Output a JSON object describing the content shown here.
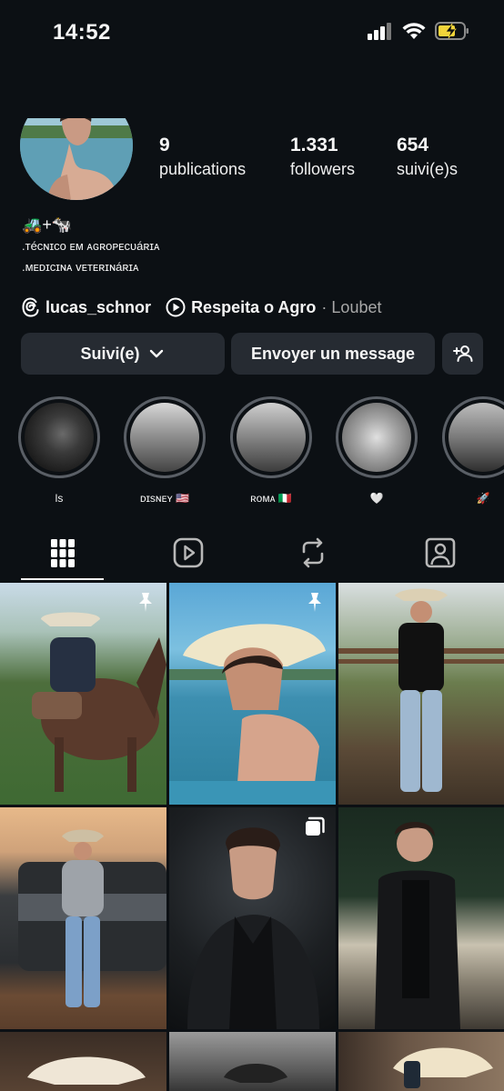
{
  "status": {
    "time": "14:52"
  },
  "header": {
    "username": "lucas_schnor"
  },
  "profile": {
    "stats": [
      {
        "value": "9",
        "label": "publications"
      },
      {
        "value": "1.331",
        "label": "followers"
      },
      {
        "value": "654",
        "label": "suivi(e)s"
      }
    ],
    "bio": [
      "🚜+🐄",
      ".ᴛéᴄɴɪᴄᴏ ᴇᴍ ᴀɢʀᴏᴘᴇᴄᴜáʀɪᴀ",
      ".ᴍᴇᴅɪᴄɪɴᴀ ᴠᴇᴛᴇʀɪɴáʀɪᴀ"
    ],
    "threads_handle": "lucas_schnor",
    "music_title": "Respeita o Agro",
    "music_artist": "· Loubet"
  },
  "actions": {
    "follow_label": "Suivi(e)",
    "message_label": "Envoyer un message"
  },
  "highlights": [
    {
      "label": "ls"
    },
    {
      "label": "ᴅɪsɴᴇʏ 🇺🇸"
    },
    {
      "label": "ʀᴏᴍᴀ 🇮🇹"
    },
    {
      "label": "🤍"
    },
    {
      "label": "🚀"
    }
  ],
  "colors": {
    "background": "#0c1014",
    "button": "#262b32",
    "muted_text": "#a8a8a8"
  },
  "icons": [
    "back-icon",
    "bell-icon",
    "more-icon",
    "threads-icon",
    "music-play-icon",
    "chevron-down-icon",
    "add-user-icon",
    "grid-icon",
    "reels-icon",
    "reposts-icon",
    "tagged-icon",
    "pin-icon",
    "multi-post-icon"
  ]
}
